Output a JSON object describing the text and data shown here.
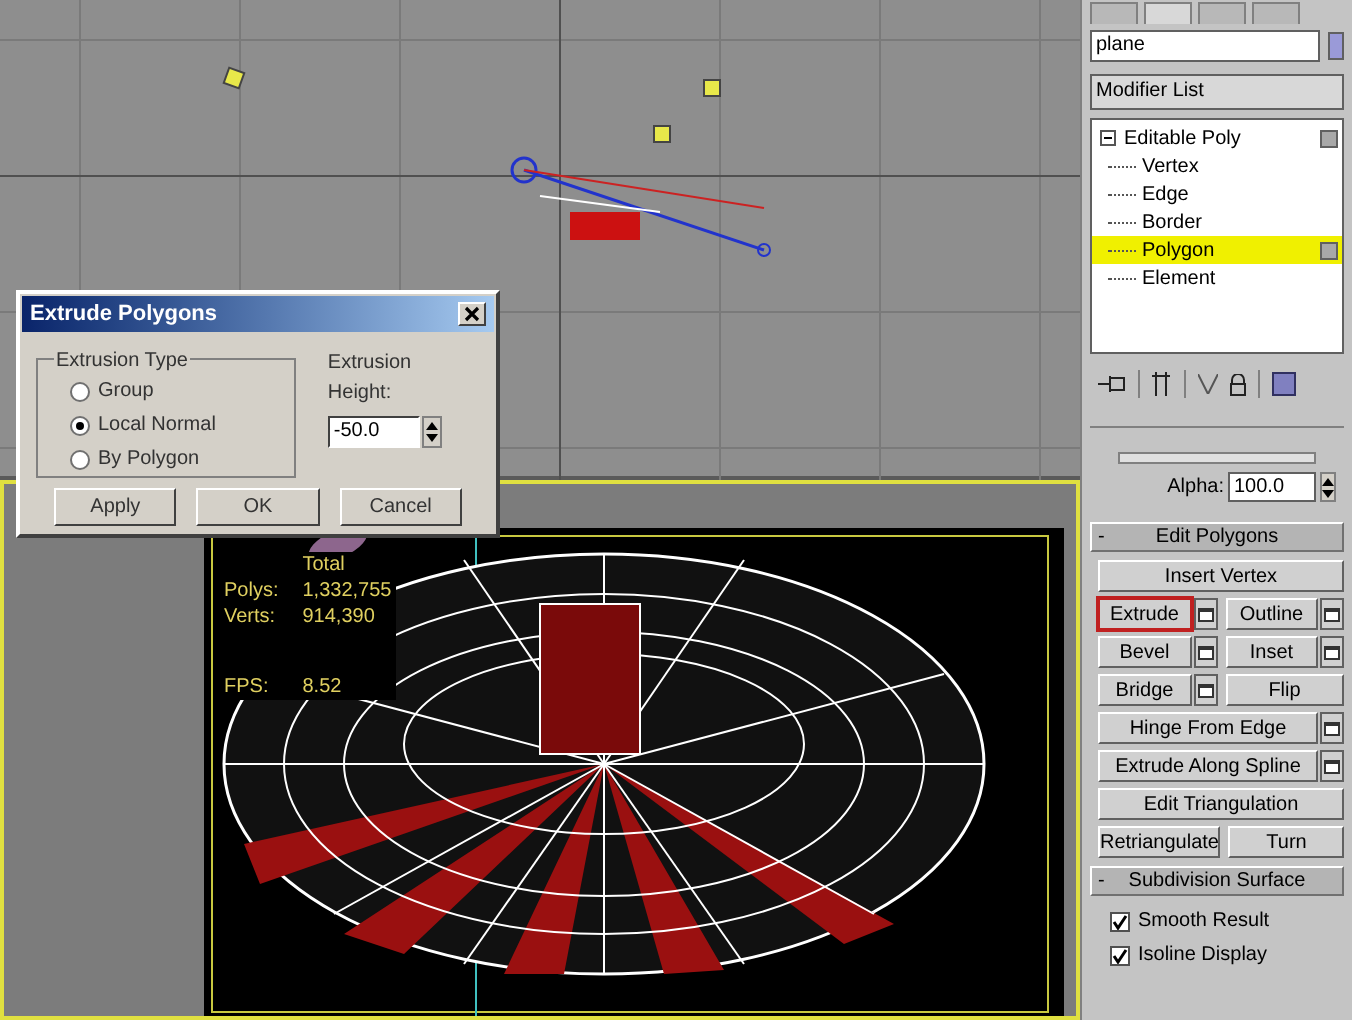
{
  "dialog": {
    "title": "Extrude Polygons",
    "group_label": "Extrusion Type",
    "options": [
      {
        "label": "Group",
        "selected": false
      },
      {
        "label": "Local Normal",
        "selected": true
      },
      {
        "label": "By Polygon",
        "selected": false
      }
    ],
    "height_label": "Extrusion Height:",
    "height_value": "-50.0",
    "buttons": [
      "Apply",
      "OK",
      "Cancel"
    ]
  },
  "viewport_stats": {
    "header": "Total",
    "rows": [
      {
        "label": "Polys:",
        "value": "1,332,755"
      },
      {
        "label": "Verts:",
        "value": "914,390"
      }
    ],
    "fps_label": "FPS:",
    "fps_value": "8.52"
  },
  "command_panel": {
    "name_field": "plane",
    "modifier_list": "Modifier List",
    "stack": [
      {
        "label": "Editable Poly",
        "expanded": true,
        "children": [
          {
            "label": "Vertex",
            "selected": false
          },
          {
            "label": "Edge",
            "selected": false
          },
          {
            "label": "Border",
            "selected": false
          },
          {
            "label": "Polygon",
            "selected": true
          },
          {
            "label": "Element",
            "selected": false
          }
        ]
      }
    ],
    "alpha_label": "Alpha:",
    "alpha_value": "100.0",
    "rollouts": [
      {
        "title": "Edit Polygons",
        "collapse": "-",
        "rows": [
          [
            {
              "label": "Insert Vertex",
              "settings": false,
              "highlighted": false
            }
          ],
          [
            {
              "label": "Extrude",
              "settings": true,
              "highlighted": true
            },
            {
              "label": "Outline",
              "settings": true,
              "highlighted": false
            }
          ],
          [
            {
              "label": "Bevel",
              "settings": true,
              "highlighted": false
            },
            {
              "label": "Inset",
              "settings": true,
              "highlighted": false
            }
          ],
          [
            {
              "label": "Bridge",
              "settings": true,
              "highlighted": false
            },
            {
              "label": "Flip",
              "settings": false,
              "highlighted": false
            }
          ],
          [
            {
              "label": "Hinge From Edge",
              "settings": true,
              "highlighted": false
            }
          ],
          [
            {
              "label": "Extrude Along Spline",
              "settings": true,
              "highlighted": false
            }
          ],
          [
            {
              "label": "Edit Triangulation",
              "settings": false,
              "highlighted": false
            }
          ],
          [
            {
              "label": "Retriangulate",
              "settings": false,
              "highlighted": false
            },
            {
              "label": "Turn",
              "settings": false,
              "highlighted": false
            }
          ]
        ]
      },
      {
        "title": "Subdivision Surface",
        "collapse": "-",
        "checkboxes": [
          {
            "label": "Smooth Result",
            "checked": true
          },
          {
            "label": "Isoline Display",
            "checked": true
          }
        ]
      }
    ]
  }
}
